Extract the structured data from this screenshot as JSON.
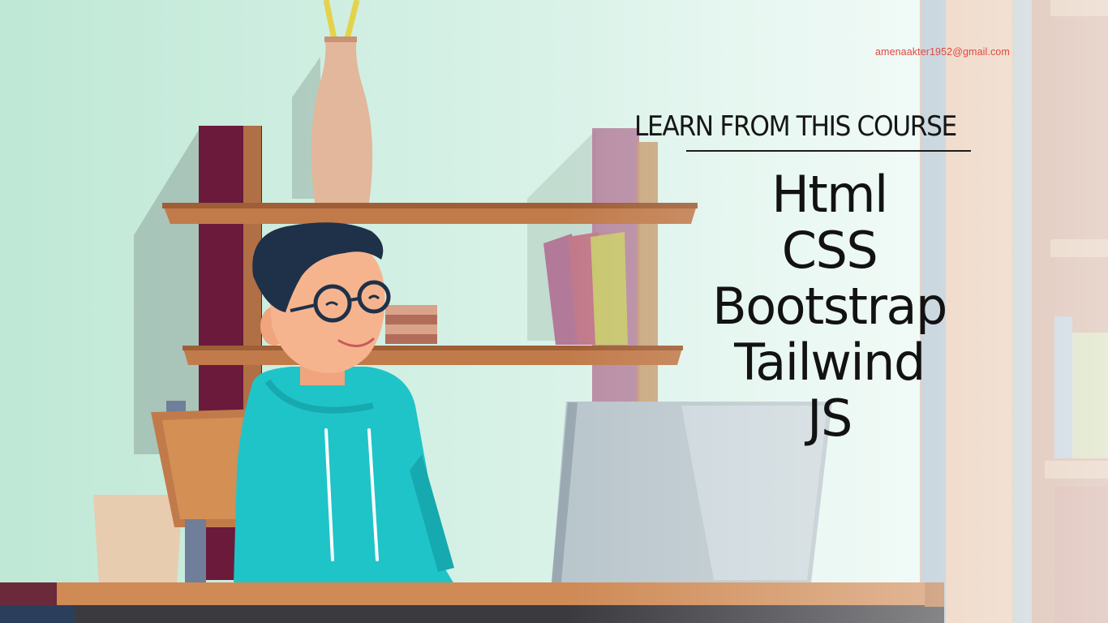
{
  "watermark": {
    "email": "amenaakter1952@gmail.com",
    "color": "#e2463f"
  },
  "course": {
    "heading": "LEARN FROM THIS COURSE",
    "topics": [
      "Html",
      "CSS",
      "Bootstrap",
      "Tailwind",
      "JS"
    ]
  },
  "palette": {
    "background": "#cfeee2",
    "hoodie": "#1fc4c8",
    "hair": "#1e3148",
    "shelf": "#b06f45",
    "laptop": "#b9c6cc"
  }
}
